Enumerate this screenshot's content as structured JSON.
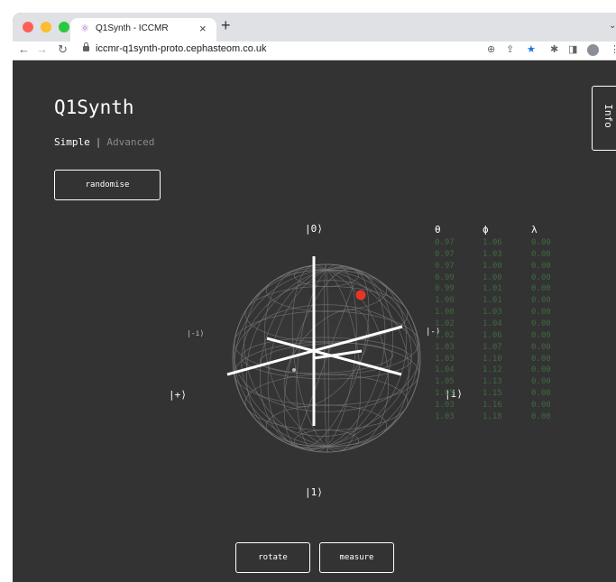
{
  "browser": {
    "tab_title": "Q1Synth - ICCMR",
    "tab_close": "×",
    "new_tab": "+",
    "url": "iccmr-q1synth-proto.cephasteom.co.uk"
  },
  "app": {
    "title": "Q1Synth",
    "mode_simple": "Simple",
    "mode_separator": "|",
    "mode_advanced": "Advanced",
    "randomise_label": "randomise",
    "info_label": "Info",
    "rotate_label": "rotate",
    "measure_label": "measure"
  },
  "bloch": {
    "label_zero": "|0⟩",
    "label_one": "|1⟩",
    "label_minus_i": "|-i⟩",
    "label_minus": "|-⟩",
    "label_plus": "|+⟩",
    "label_i": "|i⟩",
    "state_color": "#e8352a"
  },
  "table": {
    "headers": [
      "θ",
      "ϕ",
      "λ"
    ],
    "rows": [
      [
        "0.97",
        "1.06",
        "0.00"
      ],
      [
        "0.97",
        "1.03",
        "0.00"
      ],
      [
        "0.97",
        "1.00",
        "0.00"
      ],
      [
        "0.99",
        "1.00",
        "0.00"
      ],
      [
        "0.99",
        "1.01",
        "0.00"
      ],
      [
        "1.00",
        "1.01",
        "0.00"
      ],
      [
        "1.00",
        "1.03",
        "0.00"
      ],
      [
        "1.02",
        "1.04",
        "0.00"
      ],
      [
        "1.02",
        "1.06",
        "0.00"
      ],
      [
        "1.03",
        "1.07",
        "0.00"
      ],
      [
        "1.03",
        "1.10",
        "0.00"
      ],
      [
        "1.04",
        "1.12",
        "0.00"
      ],
      [
        "1.05",
        "1.13",
        "0.00"
      ],
      [
        "1.05",
        "1.15",
        "0.00"
      ],
      [
        "1.03",
        "1.16",
        "0.00"
      ],
      [
        "1.03",
        "1.18",
        "0.00"
      ]
    ]
  },
  "colors": {
    "page_background": "#333333",
    "table_value": "#3f6a3f"
  }
}
